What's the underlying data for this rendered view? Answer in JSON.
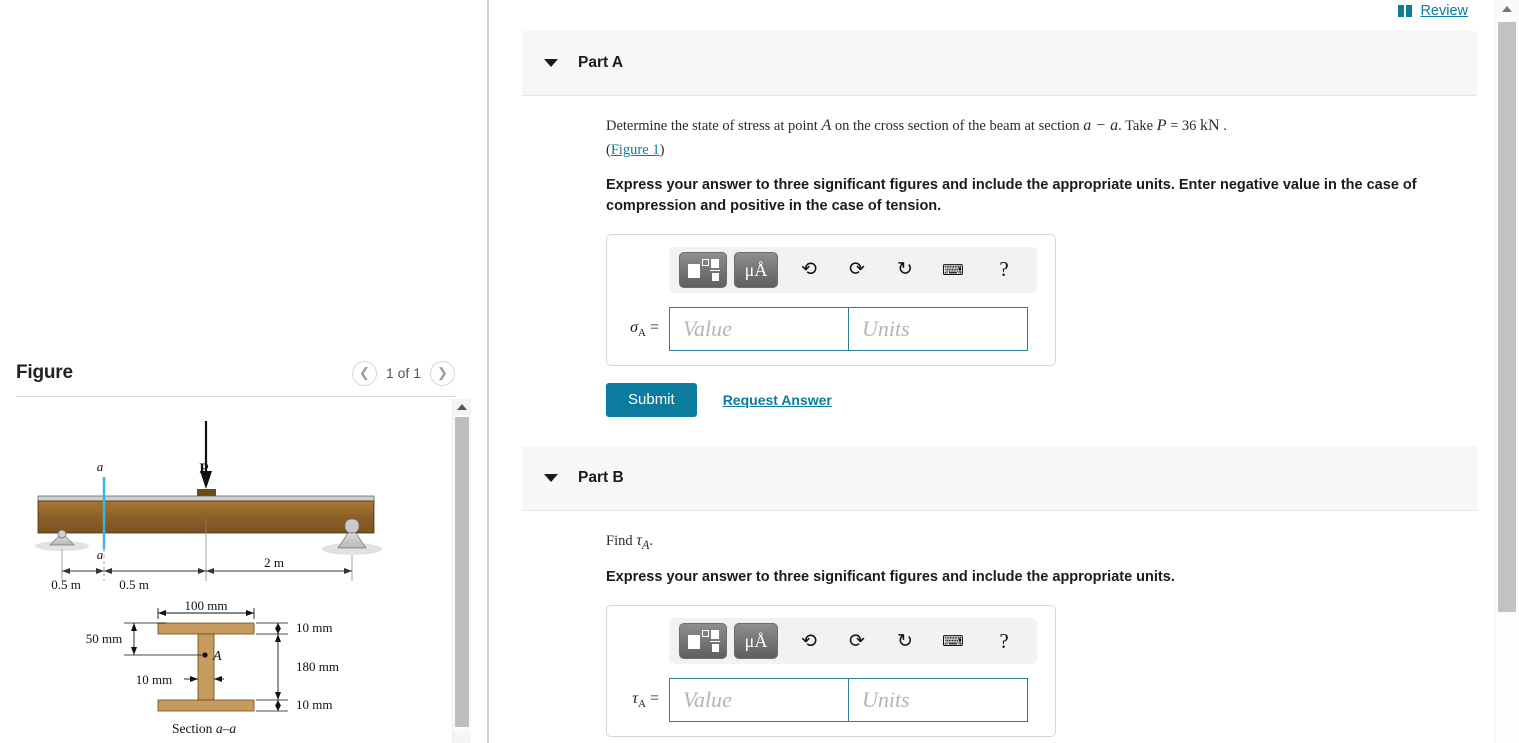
{
  "topbar": {
    "review_label": "Review",
    "book_icon": "book-icon"
  },
  "figure_panel": {
    "title": "Figure",
    "counter": "1 of 1",
    "prev_icon": "chevron-left-icon",
    "next_icon": "chevron-right-icon",
    "beam_diagram": {
      "load_label": "P",
      "section_marker_top": "a",
      "section_marker_bottom": "a",
      "dim_left": "0.5 m",
      "dim_mid": "0.5 m",
      "dim_right": "2 m"
    },
    "cross_section": {
      "caption": "Section a–a",
      "width_label": "100 mm",
      "flange_top": "10 mm",
      "flange_bottom": "10 mm",
      "web_height": "180 mm",
      "web_thickness": "10 mm",
      "point_offset": "50 mm",
      "point_label": "A"
    }
  },
  "parts": [
    {
      "id": "part-a",
      "title": "Part A",
      "caret_icon": "caret-down-icon",
      "question_pre": "Determine the state of stress at point ",
      "question_var_a": "A",
      "question_mid": " on the cross section of the beam at section ",
      "question_section": "a − a",
      "question_take": ". Take ",
      "question_p": "P",
      "question_eq": " = 36 ",
      "question_unit": "kN",
      "question_end": " .",
      "figure_link": "Figure 1",
      "instruction": "Express your answer to three significant figures and include the appropriate units. Enter negative value in the case of compression and positive in the case of tension.",
      "toolbar": {
        "template_button": "template-button",
        "units_button_label": "μÅ",
        "undo_icon": "undo-icon",
        "redo_icon": "redo-icon",
        "reset_icon": "reset-icon",
        "keyboard_icon": "keyboard-icon",
        "help_icon": "help-icon"
      },
      "answer_label_sym": "σ",
      "answer_label_sub": "A",
      "answer_label_eq": " =",
      "value_placeholder": "Value",
      "units_placeholder": "Units",
      "value": "",
      "units": "",
      "submit_label": "Submit",
      "request_answer_label": "Request Answer",
      "has_actions": true
    },
    {
      "id": "part-b",
      "title": "Part B",
      "caret_icon": "caret-down-icon",
      "question_plain": "Find ",
      "question_sym": "τ",
      "question_sub": "A",
      "question_dot": ".",
      "instruction": "Express your answer to three significant figures and include the appropriate units.",
      "toolbar": {
        "template_button": "template-button",
        "units_button_label": "μÅ",
        "undo_icon": "undo-icon",
        "redo_icon": "redo-icon",
        "reset_icon": "reset-icon",
        "keyboard_icon": "keyboard-icon",
        "help_icon": "help-icon"
      },
      "answer_label_sym": "τ",
      "answer_label_sub": "A",
      "answer_label_eq": " =",
      "value_placeholder": "Value",
      "units_placeholder": "Units",
      "value": "",
      "units": "",
      "has_actions": false
    }
  ],
  "colors": {
    "accent_teal": "#0b7b9e",
    "input_border": "#2a7c95",
    "header_band": "#f7f7f7",
    "divider": "#c3d2dd",
    "beam_brown": "#8a5d2b"
  }
}
